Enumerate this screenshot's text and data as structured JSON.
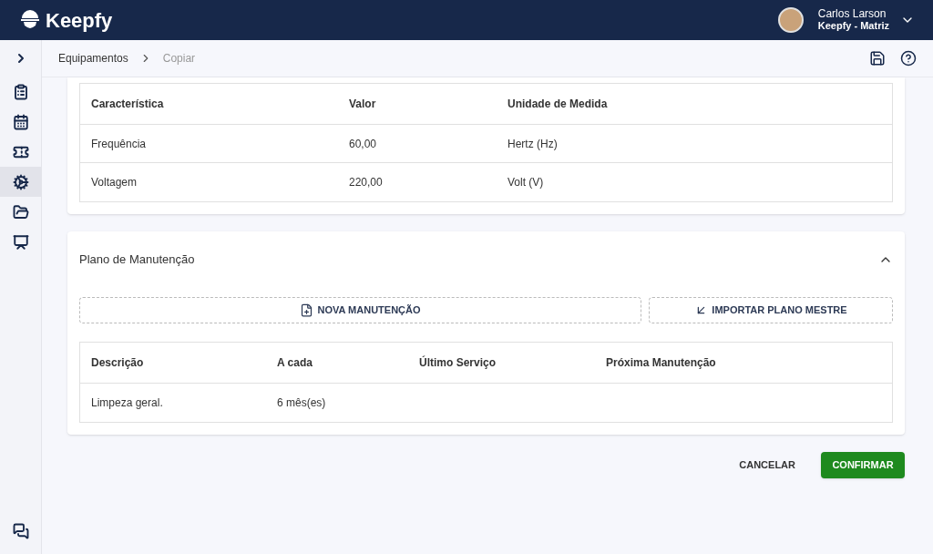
{
  "header": {
    "logo": "Keepfy",
    "user": {
      "name": "Carlos Larson",
      "company": "Keepfy - Matriz"
    }
  },
  "sidebar": {
    "items": [
      {
        "kind": "clipboard",
        "selected": false
      },
      {
        "kind": "calendar",
        "selected": false
      },
      {
        "kind": "ticket",
        "selected": false
      },
      {
        "kind": "engine",
        "selected": true
      },
      {
        "kind": "folder",
        "selected": false
      },
      {
        "kind": "monitor",
        "selected": false
      }
    ]
  },
  "breadcrumb": [
    "Equipamentos",
    "Copiar"
  ],
  "characteristics": {
    "columns": [
      "Característica",
      "Valor",
      "Unidade de Medida"
    ],
    "rows": [
      [
        "Frequência",
        "60,00",
        "Hertz (Hz)"
      ],
      [
        "Voltagem",
        "220,00",
        "Volt (V)"
      ]
    ]
  },
  "maintenance": {
    "title": "Plano de Manutenção",
    "expanded": true,
    "new_button": "NOVA MANUTENÇÃO",
    "import_button": "IMPORTAR PLANO MESTRE",
    "columns": [
      "Descrição",
      "A cada",
      "Último Serviço",
      "Próxima Manutenção"
    ],
    "rows": [
      [
        "Limpeza geral.",
        "6 mês(es)",
        "",
        ""
      ]
    ]
  },
  "actions": {
    "cancel": "CANCELAR",
    "confirm": "CONFIRMAR"
  }
}
